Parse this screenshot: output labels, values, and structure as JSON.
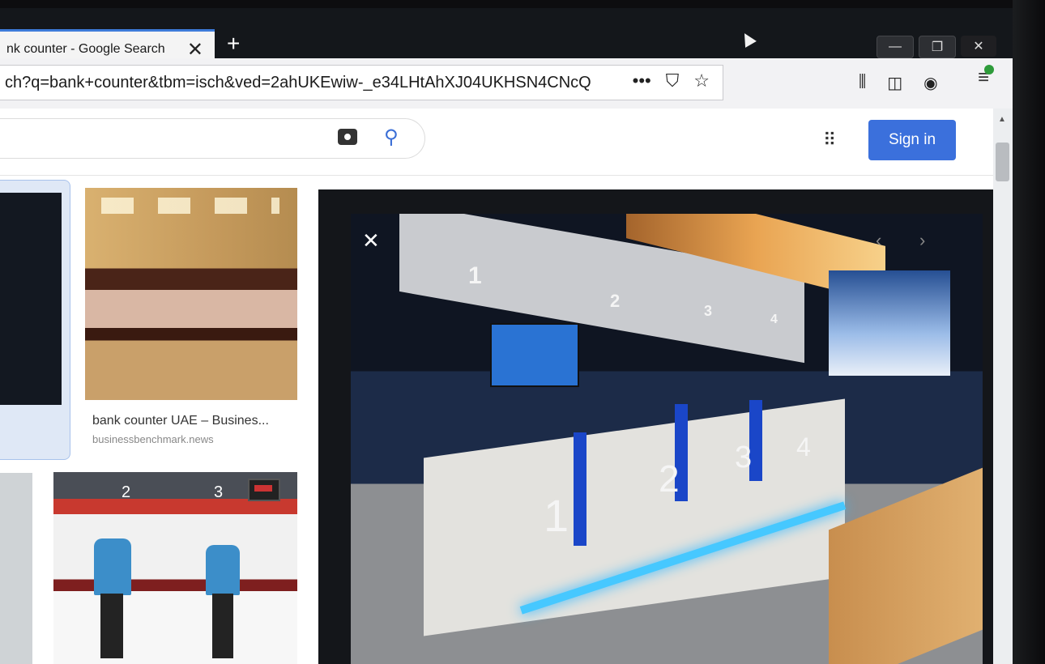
{
  "browser": {
    "tab_title": "nk counter - Google Search",
    "tab_close": "✕",
    "new_tab": "+",
    "url": "ch?q=bank+counter&tbm=isch&ved=2ahUKEwiw-_e34LHtAhXJ04UKHSN4CNcQ",
    "page_actions_more": "•••",
    "window_minimize": "—",
    "window_restore": "❐",
    "window_close": "✕"
  },
  "google": {
    "sign_in": "Sign in"
  },
  "results": {
    "item1_title": "bank counter UAE – Busines...",
    "item1_source": "businessbenchmark.news"
  },
  "preview": {
    "close": "✕",
    "prev": "‹",
    "next": "›"
  },
  "photo_numbers": {
    "sign_1": "1",
    "sign_2": "2",
    "sign_3": "3",
    "sign_4": "4",
    "counter_1": "1",
    "counter_2": "2",
    "counter_3": "3",
    "counter_4": "4"
  },
  "thumb2_numbers": {
    "n2": "2",
    "n3": "3"
  },
  "icons": [
    "camera-icon",
    "search-icon",
    "apps-icon",
    "library-icon",
    "sidebar-icon",
    "account-icon",
    "menu-icon",
    "pocket-icon",
    "star-icon"
  ]
}
